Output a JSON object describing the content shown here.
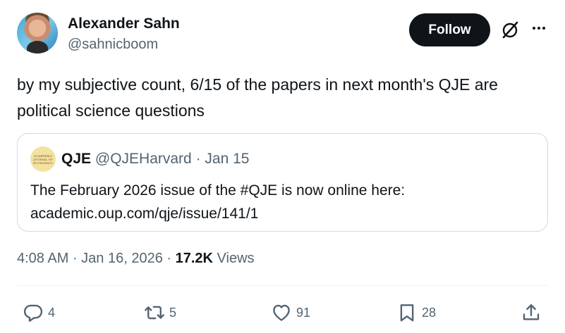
{
  "author": {
    "name": "Alexander Sahn",
    "handle": "@sahnicboom"
  },
  "header": {
    "follow_label": "Follow"
  },
  "tweet": {
    "text": "by my subjective count, 6/15 of the papers in next month's QJE are political science questions"
  },
  "quote": {
    "avatar_text": [
      "QUARTERLY",
      "JOURNAL OF",
      "ECONOMICS"
    ],
    "name": "QJE",
    "handle": "@QJEHarvard",
    "date": "Jan 15",
    "text_line1": "The February 2026 issue of the #QJE is now online here:",
    "text_line2": "academic.oup.com/qje/issue/141/1"
  },
  "meta": {
    "time": "4:08 AM",
    "date": "Jan 16, 2026",
    "views_count": "17.2K",
    "views_label": "Views"
  },
  "actions": {
    "replies": "4",
    "reposts": "5",
    "likes": "91",
    "bookmarks": "28"
  },
  "colors": {
    "text": "#0f1419",
    "secondary": "#536471",
    "border": "#cfd9de",
    "follow_bg": "#0f1419"
  },
  "icons": [
    "grok-icon",
    "more-icon",
    "reply-icon",
    "repost-icon",
    "like-icon",
    "bookmark-icon",
    "share-icon"
  ]
}
